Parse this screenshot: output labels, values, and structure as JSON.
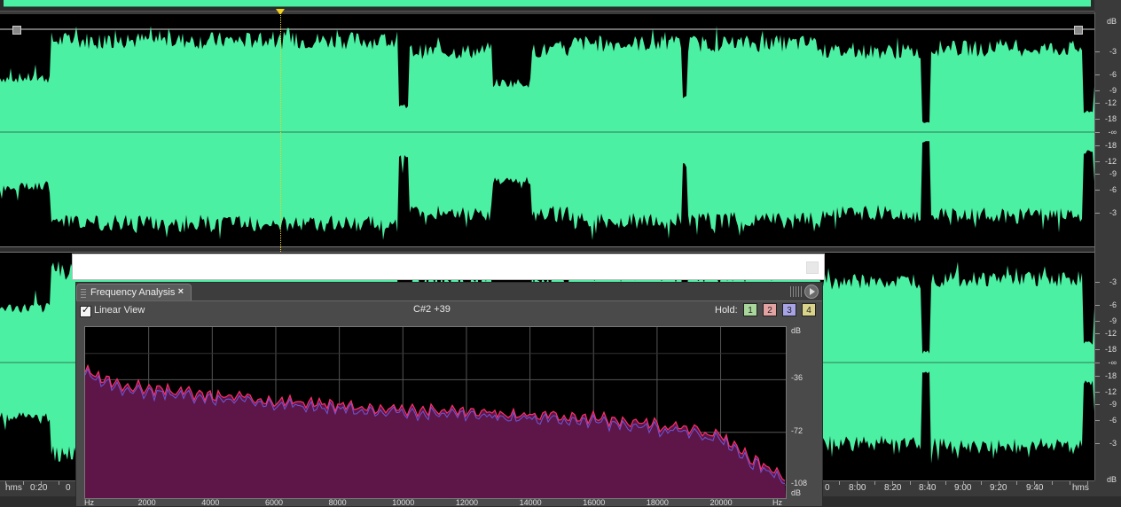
{
  "colors": {
    "waveform": "#4cf0a3",
    "spectrum_fill": "#5e1548",
    "spectrum_line_1": "#ff2f6a",
    "spectrum_line_2": "#6a6aff",
    "playhead": "#f2d21c"
  },
  "db_scale": {
    "title": "dB",
    "top_channel": [
      "-3",
      "-6",
      "-9",
      "-12",
      "-18",
      "-∞",
      "-18",
      "-12",
      "-9",
      "-6",
      "-3"
    ],
    "bottom_channel": [
      "-3",
      "-6",
      "-9",
      "-12",
      "-18",
      "-∞",
      "-18",
      "-12",
      "-9",
      "-6",
      "-3"
    ],
    "bottom_unit": "dB"
  },
  "time_ruler": {
    "left_unit": "hms",
    "right_unit": "hms",
    "left_labels": [
      "0:20",
      "0"
    ],
    "right_labels": [
      "0",
      "8:00",
      "8:20",
      "8:40",
      "9:00",
      "9:20",
      "9:40"
    ]
  },
  "panel": {
    "tab_title": "Frequency Analysis",
    "tab_close": "×",
    "linear_view_label": "Linear View",
    "linear_view_checked": true,
    "checkmark": "✓",
    "note": "C#2 +39",
    "hold_label": "Hold:",
    "hold_buttons": [
      {
        "label": "1",
        "color": "#a9d69a"
      },
      {
        "label": "2",
        "color": "#e3a3a3"
      },
      {
        "label": "3",
        "color": "#a8a3e6"
      },
      {
        "label": "4",
        "color": "#d9d48a"
      }
    ]
  },
  "chart_data": {
    "type": "area",
    "title": "",
    "xlabel": "Hz",
    "ylabel": "dB",
    "x_unit_left": "Hz",
    "x_unit_right": "Hz",
    "xlim": [
      0,
      22050
    ],
    "ylim": [
      -117,
      0
    ],
    "x_ticks": [
      "2000",
      "4000",
      "6000",
      "8000",
      "10000",
      "12000",
      "14000",
      "16000",
      "18000",
      "20000"
    ],
    "y_ticks": [
      "dB",
      "-36",
      "-72",
      "-108",
      "dB"
    ],
    "grid": true,
    "series": [
      {
        "x": [
          0,
          500,
          1000,
          2000,
          3000,
          4000,
          5000,
          6000,
          7000,
          8000,
          9000,
          10000,
          11000,
          12000,
          13000,
          14000,
          15000,
          16000,
          17000,
          18000,
          19000,
          20000,
          20500,
          21000,
          21500,
          22000
        ],
        "y": [
          -30,
          -36,
          -39,
          -42,
          -44,
          -47,
          -48,
          -50,
          -52,
          -53,
          -55,
          -56,
          -57,
          -58,
          -59,
          -60,
          -61,
          -62,
          -64,
          -67,
          -70,
          -74,
          -82,
          -90,
          -97,
          -104
        ]
      }
    ]
  }
}
